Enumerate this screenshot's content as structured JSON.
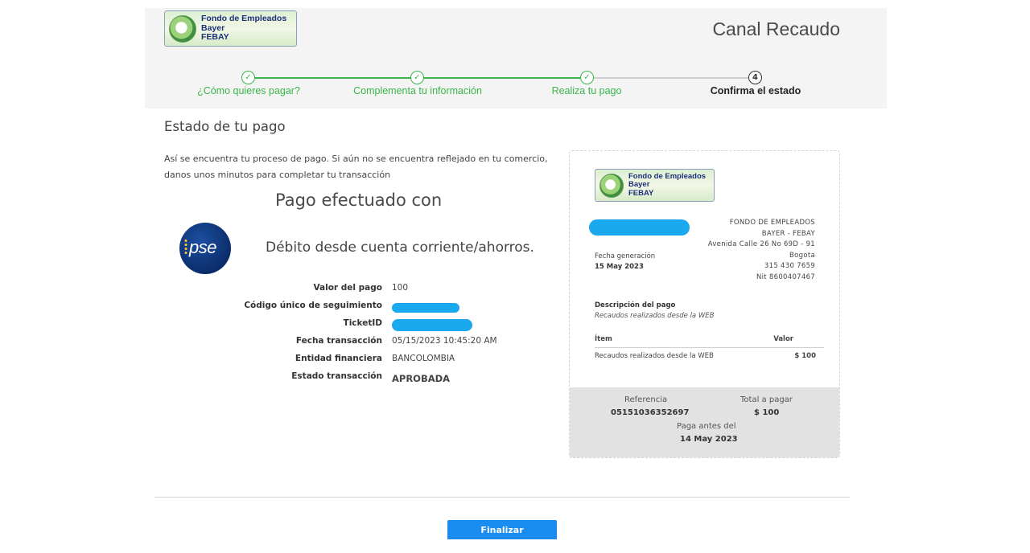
{
  "header": {
    "logo": {
      "line1": "Fondo de Empleados Bayer",
      "line2": "FEBAY"
    },
    "title": "Canal Recaudo",
    "steps": [
      {
        "num": "✓",
        "label": "¿Cómo quieres pagar?",
        "state": "done"
      },
      {
        "num": "✓",
        "label": "Complementa tu información",
        "state": "done"
      },
      {
        "num": "✓",
        "label": "Realiza tu pago",
        "state": "done"
      },
      {
        "num": "4",
        "label": "Confirma el estado",
        "state": "current"
      }
    ]
  },
  "main": {
    "section_title": "Estado de tu pago",
    "intro": "Así se encuentra tu proceso de pago. Si aún no se encuentra reflejado en tu comercio, danos unos minutos para completar tu transacción",
    "paid_title": "Pago efectuado con",
    "pse_logo": "pse",
    "method": "Débito desde cuenta corriente/ahorros.",
    "details": [
      {
        "label": "Valor del pago",
        "value": "100"
      },
      {
        "label": "Código único de seguimiento",
        "value": null
      },
      {
        "label": "TicketID",
        "value": null
      },
      {
        "label": "Fecha transacción",
        "value": "05/15/2023 10:45:20 AM"
      },
      {
        "label": "Entidad financiera",
        "value": "BANCOLOMBIA"
      },
      {
        "label": "Estado transacción",
        "value": "APROBADA"
      }
    ]
  },
  "receipt": {
    "logo": {
      "line1": "Fondo de Empleados Bayer",
      "line2": "FEBAY"
    },
    "company_lines": [
      "FONDO DE EMPLEADOS",
      "BAYER - FEBAY",
      "Avenida Calle 26 No 69D - 91",
      "Bogota",
      "315 430 7659",
      "Nit 8600407467"
    ],
    "generation_label": "Fecha generación",
    "generation_date": "15 May 2023",
    "description_label": "Descripción del pago",
    "description_value": "Recaudos realizados desde la WEB",
    "table_headers": {
      "item": "Ítem",
      "value": "Valor"
    },
    "table_rows": [
      {
        "item": "Recaudos realizados desde la WEB",
        "value": "$ 100"
      }
    ],
    "reference_label": "Referencia",
    "reference_value": "05151036352697",
    "total_label": "Total a pagar",
    "total_value": "$ 100",
    "due_label": "Paga antes del",
    "due_value": "14 May 2023"
  },
  "actions": {
    "finalize_label": "Finalizar"
  },
  "colors": {
    "accent_green": "#3ab54a",
    "primary_blue": "#1a8cf0",
    "redaction_blue": "#1aa8ef"
  }
}
